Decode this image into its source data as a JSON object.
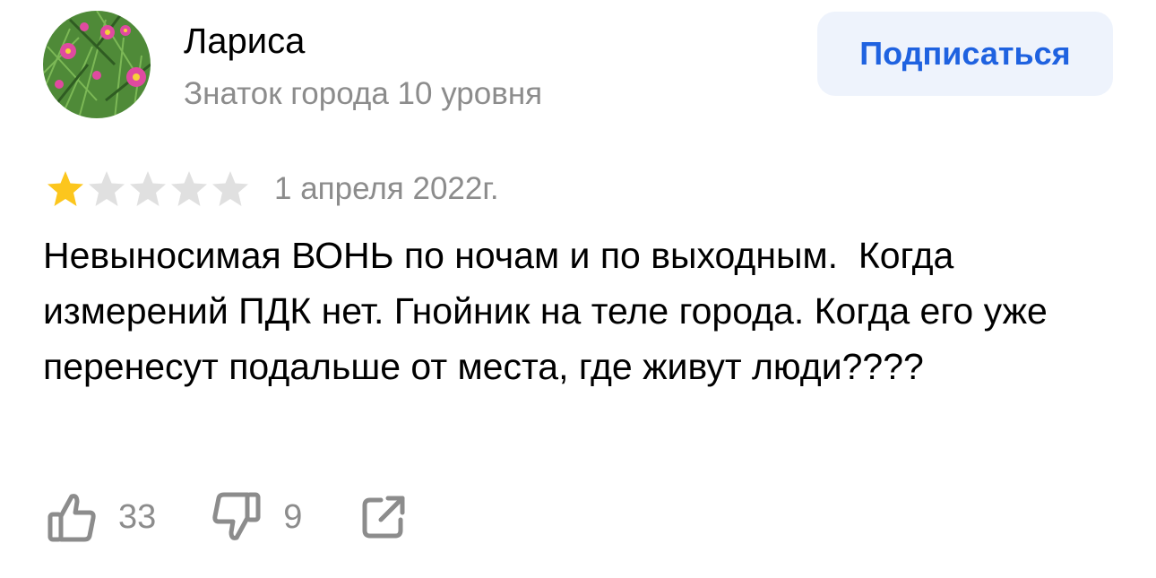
{
  "author": {
    "name": "Лариса",
    "level": "Знаток города 10 уровня",
    "avatar_icon": "pink-aster-flower-avatar"
  },
  "subscribe": {
    "label": "Подписаться"
  },
  "review": {
    "rating": 1,
    "rating_max": 5,
    "date": "1 апреля 2022г.",
    "text": "Невыносимая ВОНЬ по ночам и по выходным.  Когда измерений ПДК нет. Гнойник на теле города. Когда его уже перенесут подальше от места, где живут люди????"
  },
  "actions": {
    "likes": "33",
    "dislikes": "9",
    "like_icon": "thumbs-up-icon",
    "dislike_icon": "thumbs-down-icon",
    "share_icon": "share-icon"
  },
  "colors": {
    "star_filled": "#fcc61d",
    "star_empty": "#e0e0e0",
    "accent": "#1f62e0",
    "button_bg": "#eef3fc",
    "secondary_text": "#8c8c8c"
  }
}
